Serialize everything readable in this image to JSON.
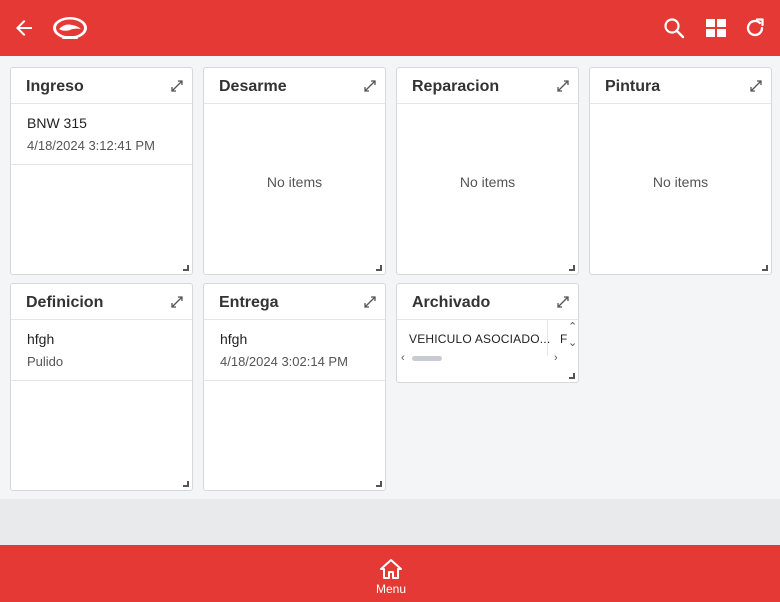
{
  "header": {
    "back_icon": "arrow-left-icon",
    "logo_icon": "brand-logo",
    "search_icon": "search-icon",
    "grid_icon": "grid-view-icon",
    "refresh_icon": "refresh-icon",
    "bar_color": "#e53935"
  },
  "columns": [
    {
      "title": "Ingreso",
      "items": [
        {
          "title": "BNW 315",
          "subtitle": "4/18/2024 3:12:41 PM"
        }
      ]
    },
    {
      "title": "Desarme",
      "empty_text": "No items"
    },
    {
      "title": "Reparacion",
      "empty_text": "No items"
    },
    {
      "title": "Pintura",
      "empty_text": "No items"
    },
    {
      "title": "Definicion",
      "items": [
        {
          "title": "hfgh",
          "subtitle": "Pulido"
        }
      ]
    },
    {
      "title": "Entrega",
      "items": [
        {
          "title": "hfgh",
          "subtitle": "4/18/2024 3:02:14 PM"
        }
      ]
    },
    {
      "title": "Archivado",
      "table_columns": [
        "VEHICULO ASOCIADO...",
        "F"
      ]
    }
  ],
  "footer": {
    "menu_label": "Menu",
    "menu_icon": "home-icon",
    "bar_color": "#e53935"
  }
}
